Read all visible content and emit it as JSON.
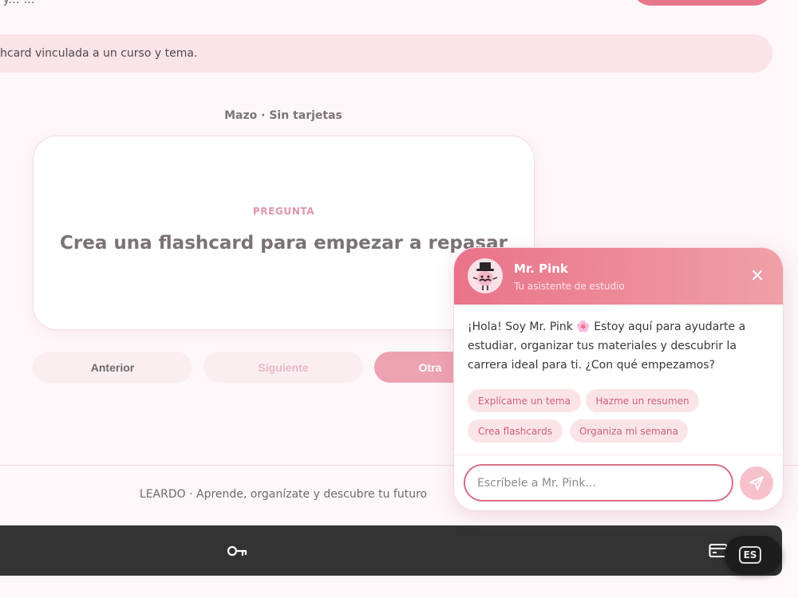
{
  "top": {
    "cut_text": ", y... ..."
  },
  "banner": {
    "text": "hcard vinculada a un curso y tema."
  },
  "deck": {
    "label": "Mazo · Sin tarjetas"
  },
  "card": {
    "label": "PREGUNTA",
    "question": "Crea una flashcard para empezar a repasar"
  },
  "nav": {
    "prev": "Anterior",
    "next": "Siguiente",
    "other": "Otra"
  },
  "footer": {
    "text": "LEARDO · Aprende, organízate y descubre tu futuro"
  },
  "bottom_bar": {
    "key_icon": "key-icon",
    "card_icon": "credit-card-icon",
    "language": "ES"
  },
  "chat": {
    "name": "Mr. Pink",
    "subtitle": "Tu asistente de estudio",
    "message": "¡Hola! Soy Mr. Pink 🌸 Estoy aquí para ayudarte a estudiar, organizar tus materiales y descubrir la carrera ideal para ti. ¿Con qué empezamos?",
    "chips": [
      "Explícame un tema",
      "Hazme un resumen",
      "Crea flashcards",
      "Organiza mi semana"
    ],
    "input_placeholder": "Escríbele a Mr. Pink...",
    "colors": {
      "header_start": "#e9738a",
      "header_end": "#f0a0a8",
      "accent": "#db6f87"
    }
  }
}
